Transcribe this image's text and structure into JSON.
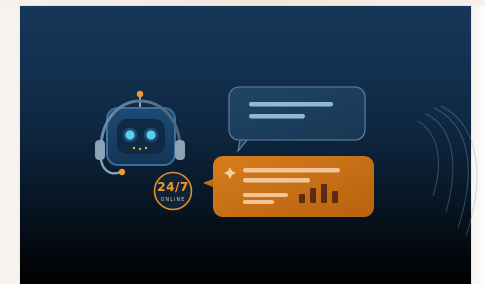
{
  "badge": {
    "main_text": "24/7",
    "sub_text": "ONLINE"
  },
  "colors": {
    "accent": "#f59a23",
    "accent_dark": "#c96f15",
    "robot_face": "#163d61",
    "robot_eye": "#5bd4f0",
    "bubble_blue": "#1c3c5c",
    "line_light": "#8fb7d7"
  },
  "icons": {
    "robot": "robot-icon",
    "spark": "sparkle-icon",
    "bars": "bar-chart-icon"
  }
}
